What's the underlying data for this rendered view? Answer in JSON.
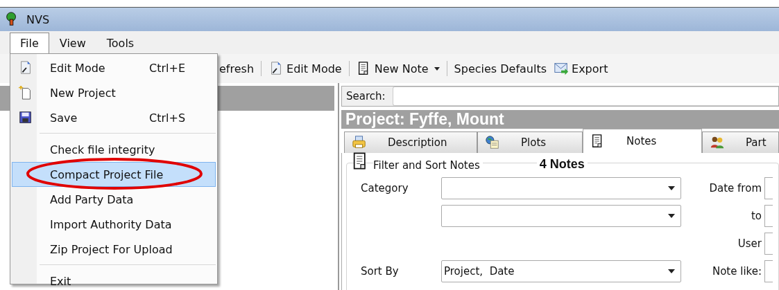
{
  "window": {
    "title": "NVS"
  },
  "menu_bar": [
    {
      "label": "File",
      "selected": true
    },
    {
      "label": "View",
      "selected": false
    },
    {
      "label": "Tools",
      "selected": false
    }
  ],
  "file_menu": {
    "items": [
      {
        "kind": "item",
        "label": "Edit Mode",
        "shortcut": "Ctrl+E",
        "selected": false,
        "circled": false
      },
      {
        "kind": "item",
        "label": "New Project",
        "selected": false,
        "circled": false
      },
      {
        "kind": "item",
        "label": "Save",
        "shortcut": "Ctrl+S",
        "selected": false,
        "circled": false
      },
      {
        "kind": "separator"
      },
      {
        "kind": "item",
        "label": "Check file integrity",
        "selected": false,
        "circled": false
      },
      {
        "kind": "item",
        "label": "Compact Project File",
        "selected": true,
        "circled": true
      },
      {
        "kind": "item",
        "label": "Add Party Data",
        "selected": false,
        "circled": false
      },
      {
        "kind": "item",
        "label": "Import Authority Data",
        "selected": false,
        "circled": false
      },
      {
        "kind": "item",
        "label": "Zip Project For Upload",
        "selected": false,
        "circled": false
      },
      {
        "kind": "separator"
      },
      {
        "kind": "item",
        "label": "Exit",
        "selected": false,
        "circled": false
      }
    ]
  },
  "toolbar": [
    {
      "kind": "button",
      "label": "efresh"
    },
    {
      "kind": "separator"
    },
    {
      "kind": "button",
      "label": "Edit Mode"
    },
    {
      "kind": "separator"
    },
    {
      "kind": "dropdown",
      "label": "New Note"
    },
    {
      "kind": "separator"
    },
    {
      "kind": "button",
      "label": "Species Defaults"
    },
    {
      "kind": "button",
      "label": "Export"
    }
  ],
  "search": {
    "label": "Search:"
  },
  "project_title": "Project: Fyffe, Mount",
  "tabs": [
    {
      "label": "Description",
      "selected": false
    },
    {
      "label": "Plots",
      "selected": false
    },
    {
      "label": "Notes",
      "selected": true
    },
    {
      "label": "Part",
      "selected": false
    }
  ],
  "filter": {
    "title": "Filter and Sort Notes",
    "count": "4 Notes",
    "rows": [
      {
        "label": "Category",
        "kind": "combo",
        "right_label": "Date from"
      },
      {
        "kind": "combo",
        "right_label": "to"
      },
      {
        "kind": "blank",
        "right_label": "User"
      },
      {
        "label": "Sort By",
        "kind": "combo",
        "value": "Project,  Date",
        "right_label": "Note like:"
      }
    ]
  }
}
